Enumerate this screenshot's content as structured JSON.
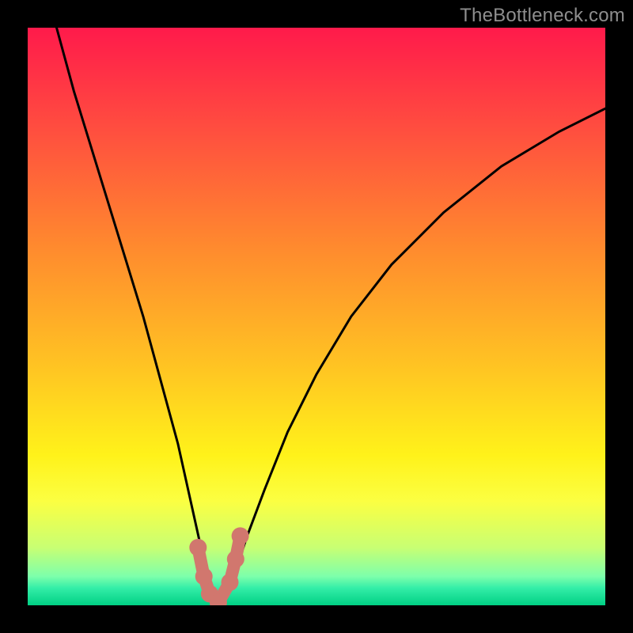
{
  "watermark": "TheBottleneck.com",
  "chart_data": {
    "type": "line",
    "title": "",
    "xlabel": "",
    "ylabel": "",
    "xlim": [
      0,
      100
    ],
    "ylim": [
      0,
      100
    ],
    "series": [
      {
        "name": "bottleneck-curve",
        "x": [
          5,
          8,
          12,
          16,
          20,
          23,
          26,
          28,
          30,
          31,
          32,
          33,
          34,
          36,
          38,
          41,
          45,
          50,
          56,
          63,
          72,
          82,
          92,
          100
        ],
        "y": [
          100,
          89,
          76,
          63,
          50,
          39,
          28,
          19,
          10,
          5,
          2,
          0,
          2,
          6,
          12,
          20,
          30,
          40,
          50,
          59,
          68,
          76,
          82,
          86
        ]
      }
    ],
    "markers": {
      "name": "highlight-points",
      "color": "#d1776e",
      "points": [
        {
          "x": 29.5,
          "y": 10
        },
        {
          "x": 30.5,
          "y": 5
        },
        {
          "x": 31.5,
          "y": 2
        },
        {
          "x": 33.0,
          "y": 0.5
        },
        {
          "x": 35.0,
          "y": 4
        },
        {
          "x": 36.0,
          "y": 8
        },
        {
          "x": 36.8,
          "y": 12
        }
      ]
    },
    "gradient_stops": [
      {
        "pos": 0.0,
        "color": "#ff1a4b"
      },
      {
        "pos": 0.18,
        "color": "#ff4f3f"
      },
      {
        "pos": 0.38,
        "color": "#ff8a2e"
      },
      {
        "pos": 0.58,
        "color": "#ffc223"
      },
      {
        "pos": 0.74,
        "color": "#fff21a"
      },
      {
        "pos": 0.82,
        "color": "#fbff42"
      },
      {
        "pos": 0.9,
        "color": "#c8ff73"
      },
      {
        "pos": 0.95,
        "color": "#7dffab"
      },
      {
        "pos": 0.97,
        "color": "#34eea8"
      },
      {
        "pos": 1.0,
        "color": "#00d084"
      }
    ]
  }
}
